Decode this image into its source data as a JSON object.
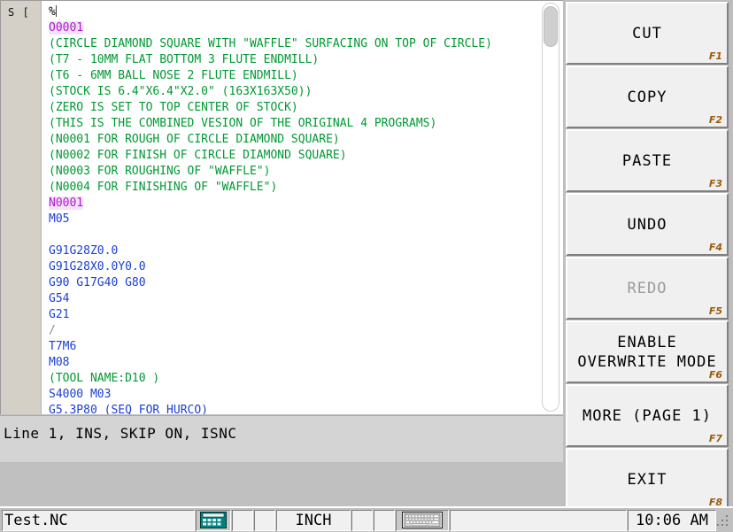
{
  "editor": {
    "gutter_text": "S [",
    "lines": [
      {
        "text": "%",
        "style": "plain",
        "caret": true
      },
      {
        "text": "O0001",
        "style": "label"
      },
      {
        "text": "(CIRCLE DIAMOND SQUARE WITH \"WAFFLE\" SURFACING ON TOP OF CIRCLE)",
        "style": "comment"
      },
      {
        "text": "(T7 - 10MM FLAT BOTTOM 3 FLUTE ENDMILL)",
        "style": "comment"
      },
      {
        "text": "(T6 - 6MM BALL NOSE 2 FLUTE ENDMILL)",
        "style": "comment"
      },
      {
        "text": "(STOCK IS 6.4\"X6.4\"X2.0\" (163X163X50))",
        "style": "comment"
      },
      {
        "text": "(ZERO IS SET TO TOP CENTER OF STOCK)",
        "style": "comment"
      },
      {
        "text": "(THIS IS THE COMBINED VESION OF THE ORIGINAL 4 PROGRAMS)",
        "style": "comment"
      },
      {
        "text": "(N0001 FOR ROUGH OF CIRCLE DIAMOND SQUARE)",
        "style": "comment"
      },
      {
        "text": "(N0002 FOR FINISH OF CIRCLE DIAMOND SQUARE)",
        "style": "comment"
      },
      {
        "text": "(N0003 FOR ROUGHING OF \"WAFFLE\")",
        "style": "comment"
      },
      {
        "text": "(N0004 FOR FINISHING OF \"WAFFLE\")",
        "style": "comment"
      },
      {
        "text": "N0001",
        "style": "label"
      },
      {
        "text": "M05",
        "style": "code"
      },
      {
        "text": "",
        "style": "blank"
      },
      {
        "text": "G91G28Z0.0",
        "style": "code"
      },
      {
        "text": "G91G28X0.0Y0.0",
        "style": "code"
      },
      {
        "text": "G90 G17G40 G80",
        "style": "code"
      },
      {
        "text": "G54",
        "style": "code"
      },
      {
        "text": "G21",
        "style": "code"
      },
      {
        "text": "/",
        "style": "slash"
      },
      {
        "text": "T7M6",
        "style": "code"
      },
      {
        "text": "M08",
        "style": "code"
      },
      {
        "text": "(TOOL NAME:D10 )",
        "style": "comment"
      },
      {
        "text": "S4000 M03",
        "style": "code"
      },
      {
        "text": "G5.3P80 (SEQ FOR HURCO)",
        "style": "code"
      }
    ]
  },
  "status_line": {
    "text": "Line 1, INS, SKIP ON, ISNC"
  },
  "softkeys": [
    {
      "label": "CUT",
      "fkey": "F1",
      "enabled": true
    },
    {
      "label": "COPY",
      "fkey": "F2",
      "enabled": true
    },
    {
      "label": "PASTE",
      "fkey": "F3",
      "enabled": true
    },
    {
      "label": "UNDO",
      "fkey": "F4",
      "enabled": true
    },
    {
      "label": "REDO",
      "fkey": "F5",
      "enabled": false
    },
    {
      "label": "ENABLE\nOVERWRITE MODE",
      "fkey": "F6",
      "enabled": true
    },
    {
      "label": "MORE (PAGE 1)",
      "fkey": "F7",
      "enabled": true
    },
    {
      "label": "EXIT",
      "fkey": "F8",
      "enabled": true
    }
  ],
  "taskbar": {
    "filename": "Test.NC",
    "calculator_icon": "calculator-icon",
    "units": "INCH",
    "keyboard_icon": "keyboard-icon",
    "clock": "10:06 AM"
  },
  "colors": {
    "comment": "#009933",
    "code": "#1a3fd4",
    "label": "#b01ad0",
    "label_highlight": "#f2e3fa",
    "fkey": "#9c5b0a",
    "disabled_text": "#9a9a9a",
    "panel_bg": "#c0c0c0",
    "button_face": "#f0f0f0",
    "calc_icon_teal": "#008080"
  }
}
